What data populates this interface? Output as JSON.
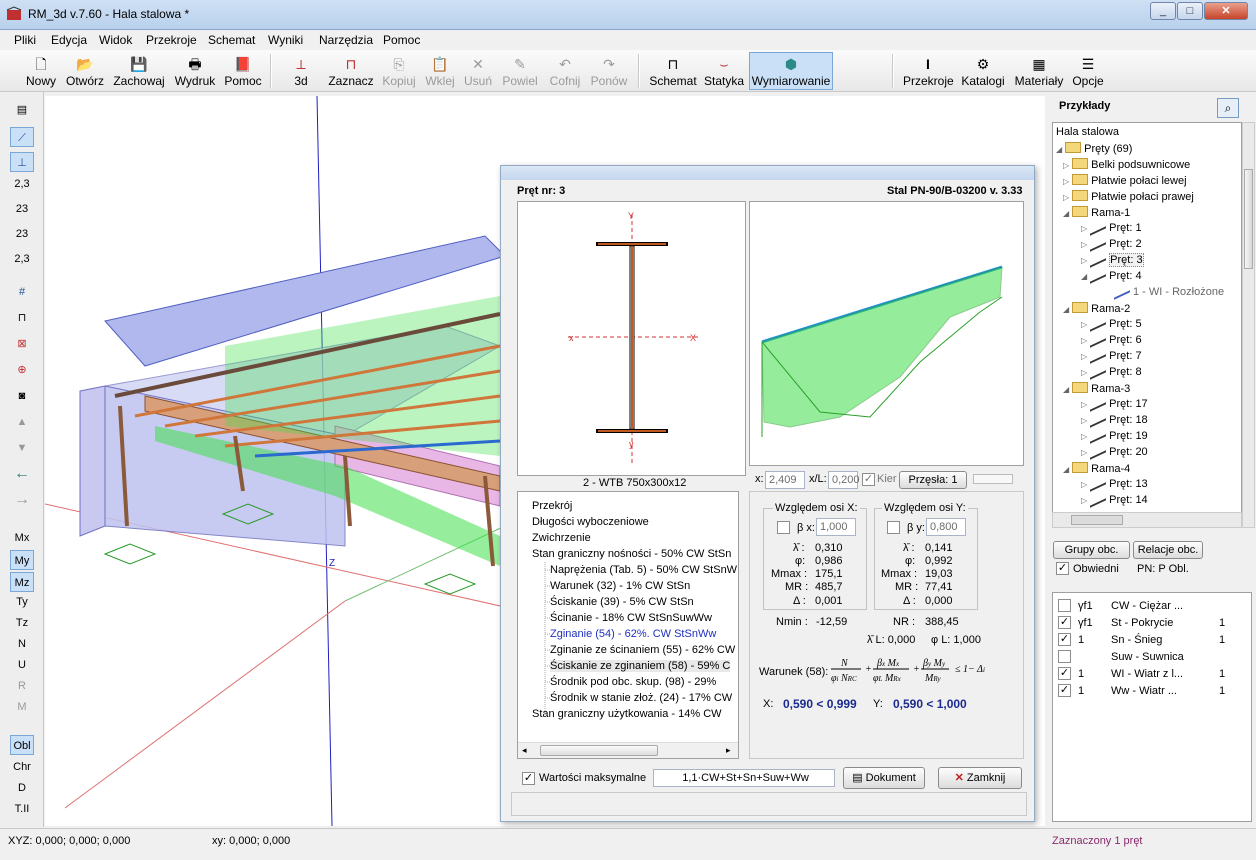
{
  "window": {
    "title": "RM_3d v.7.60 - Hala stalowa *"
  },
  "menu": [
    "Pliki",
    "Edycja",
    "Widok",
    "Przekroje",
    "Schemat",
    "Wyniki",
    "Narzędzia",
    "Pomoc"
  ],
  "toolbar": {
    "nowy": "Nowy",
    "otworz": "Otwórz",
    "zachowaj": "Zachowaj",
    "wydruk": "Wydruk",
    "pomoc": "Pomoc",
    "d3": "3d",
    "zaznacz": "Zaznacz",
    "kopiuj": "Kopiuj",
    "wklej": "Wklej",
    "usun": "Usuń",
    "powiel": "Powiel",
    "cofnij": "Cofnij",
    "ponow": "Ponów",
    "schemat": "Schemat",
    "statyka": "Statyka",
    "wymiarowanie": "Wymiarowanie",
    "przekroje": "Przekroje",
    "katalogi": "Katalogi",
    "materialy": "Materiały",
    "opcje": "Opcje"
  },
  "left_toolbar": {
    "n1": "2,3",
    "n2": "23",
    "n3": "23",
    "n4": "2,3",
    "labels": [
      "Mx",
      "My",
      "Mz",
      "Ty",
      "Tz",
      "N",
      "U",
      "R",
      "M"
    ],
    "bottom": [
      "Obl",
      "Chr",
      "D",
      "T.II"
    ]
  },
  "dialog": {
    "pret_nr": "Pręt nr:  3",
    "norm": "Stal PN-90/B-03200 v. 3.33",
    "section_name": "2 - WTB 750x300x12",
    "x_label": "x:",
    "x_value": "2,409",
    "xl_label": "x/L:",
    "xl_value": "0,200",
    "kier_label": "Kier",
    "przesla_label": "Przęsła: 1",
    "tree": [
      "Przekrój",
      "Długości wyboczeniowe",
      "Zwichrzenie",
      "Stan graniczny nośności - 50%   CW StSn",
      "Naprężenia (Tab. 5) - 50%   CW StSnW",
      "Warunek (32) - 1%   CW StSn",
      "Ściskanie (39) - 5%   CW StSn",
      "Ścinanie - 18%   CW StSnSuwWw",
      "Zginanie (54) - 62%.   CW StSnWw",
      "Zginanie ze ścinaniem (55) - 62%   CW",
      "Ściskanie ze zginaniem (58) - 59%   C",
      "Środnik pod obc. skup. (98) - 29%",
      "Środnik w stanie złoż. (24) - 17%   CW",
      "Stan graniczny użytkowania - 14%   CW"
    ],
    "axisx": {
      "title": "Względem osi X:",
      "beta_label": "β x:",
      "beta_value": "1,000",
      "lam_label": "λ̄ :",
      "lam": "0,310",
      "phi_label": "φ:",
      "phi": "0,986",
      "mmax_label": "Mmax :",
      "mmax": "175,1",
      "mr_label": "MR :",
      "mr": "485,7",
      "delta_label": "Δ :",
      "delta": "0,001"
    },
    "axisy": {
      "title": "Względem osi Y:",
      "beta_label": "β y:",
      "beta_value": "0,800",
      "lam_label": "λ̄ :",
      "lam": "0,141",
      "phi_label": "φ:",
      "phi": "0,992",
      "mmax_label": "Mmax :",
      "mmax": "19,03",
      "mr_label": "MR :",
      "mr": "77,41",
      "delta_label": "Δ :",
      "delta": "0,000"
    },
    "nmin_label": "Nmin :",
    "nmin": "-12,59",
    "nr_label": "NR :",
    "nr": "388,45",
    "laml_label": "λ̄ L: 0,000",
    "phil_label": "φ L: 1,000",
    "warunek": "Warunek (58):",
    "res_x_label": "X:",
    "res_x": "0,590 < 0,999",
    "res_y_label": "Y:",
    "res_y": "0,590 < 1,000",
    "wartosci_label": "Wartości maksymalne",
    "combo": "1,1·CW+St+Sn+Suw+Ww",
    "dokument": "Dokument",
    "zamknij": "Zamknij"
  },
  "right_panel": {
    "title": "Przykłady",
    "tree_root": "Hala stalowa",
    "tree": [
      {
        "t": "folder",
        "label": "Pręty (69)",
        "lvl": 0
      },
      {
        "t": "folder",
        "label": "Belki podsuwnicowe",
        "lvl": 1
      },
      {
        "t": "folder",
        "label": "Płatwie połaci lewej",
        "lvl": 1
      },
      {
        "t": "folder",
        "label": "Płatwie połaci prawej",
        "lvl": 1
      },
      {
        "t": "folder",
        "label": "Rama-1",
        "lvl": 1
      },
      {
        "t": "bar",
        "label": "Pręt: 1",
        "lvl": 2
      },
      {
        "t": "bar",
        "label": "Pręt: 2",
        "lvl": 2
      },
      {
        "t": "bar",
        "label": "Pręt: 3",
        "lvl": 2
      },
      {
        "t": "bar",
        "label": "Pręt: 4",
        "lvl": 2
      },
      {
        "t": "sec",
        "label": "1 - WI - Rozłożone",
        "lvl": 3
      },
      {
        "t": "folder",
        "label": "Rama-2",
        "lvl": 1
      },
      {
        "t": "bar",
        "label": "Pręt: 5",
        "lvl": 2
      },
      {
        "t": "bar",
        "label": "Pręt: 6",
        "lvl": 2
      },
      {
        "t": "bar",
        "label": "Pręt: 7",
        "lvl": 2
      },
      {
        "t": "bar",
        "label": "Pręt: 8",
        "lvl": 2
      },
      {
        "t": "folder",
        "label": "Rama-3",
        "lvl": 1
      },
      {
        "t": "bar",
        "label": "Pręt: 17",
        "lvl": 2
      },
      {
        "t": "bar",
        "label": "Pręt: 18",
        "lvl": 2
      },
      {
        "t": "bar",
        "label": "Pręt: 19",
        "lvl": 2
      },
      {
        "t": "bar",
        "label": "Pręt: 20",
        "lvl": 2
      },
      {
        "t": "folder",
        "label": "Rama-4",
        "lvl": 1
      },
      {
        "t": "bar",
        "label": "Pręt: 13",
        "lvl": 2
      },
      {
        "t": "bar",
        "label": "Pręt: 14",
        "lvl": 2
      }
    ],
    "grupy_btn": "Grupy obc.",
    "relacje_btn": "Relacje obc.",
    "obwiedni": "Obwiedni",
    "pn_label": "PN:  P Obl.",
    "loads": [
      {
        "checked": false,
        "c1": "γf1",
        "name": "CW - Ciężar ...",
        "v": ""
      },
      {
        "checked": true,
        "c1": "γf1",
        "name": "St - Pokrycie",
        "v": "1"
      },
      {
        "checked": true,
        "c1": "1",
        "name": "Sn - Śnieg",
        "v": "1"
      },
      {
        "checked": false,
        "c1": "",
        "name": "Suw - Suwnica",
        "v": ""
      },
      {
        "checked": true,
        "c1": "1",
        "name": "WI - Wiatr z l...",
        "v": "1"
      },
      {
        "checked": true,
        "c1": "1",
        "name": "Ww - Wiatr ...",
        "v": "1"
      }
    ]
  },
  "status": {
    "xyz": "XYZ: 0,000; 0,000; 0,000",
    "xy": "xy: 0,000; 0,000",
    "selected": "Zaznaczony 1 pręt"
  }
}
